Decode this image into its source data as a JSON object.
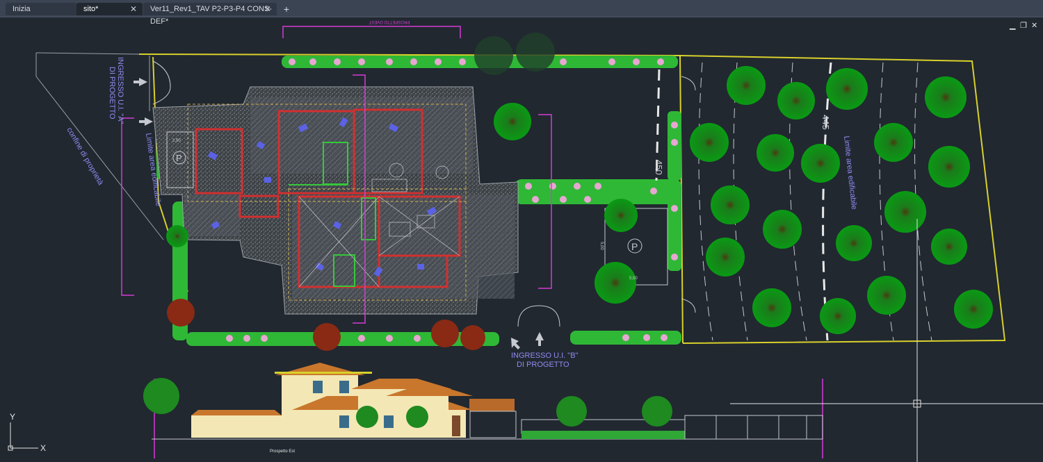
{
  "tabs": [
    {
      "label": "Inizia",
      "active": false,
      "closable": false
    },
    {
      "label": "sito*",
      "active": true,
      "closable": true
    },
    {
      "label": "Ver11_Rev1_TAV P2-P3-P4 CONS-DEF*",
      "active": false,
      "closable": true
    }
  ],
  "tab_close_symbol": "✕",
  "tab_add_symbol": "+",
  "window_controls": {
    "minimize": "▁",
    "restore": "❐",
    "close": "✕"
  },
  "drawing": {
    "entrance_a": "INGRESSO U.I. \"A\" DI PROGETTO",
    "entrance_a_line1": "INGRESSO U.I. \"A\"",
    "entrance_a_line2": "DI PROGETTO",
    "property_line": "confine di proprietà",
    "limit_left": "Limite area edificabile",
    "limit_right": "Limite area edificabile",
    "entrance_b_line1": "INGRESSO U.I. \"B\"",
    "entrance_b_line2": "DI PROGETTO",
    "elevation_title": "Prospetto Est",
    "dim_450": "450",
    "dim_445": "445",
    "parking_symbol": "P",
    "dim_250": "2,50",
    "dim_500": "5,00",
    "dim_550": "5,50",
    "top_section_label": "PROSPETTO OVEST"
  },
  "ucs": {
    "y": "Y",
    "x": "X"
  },
  "colors": {
    "background": "#212830",
    "tabbar": "#3b4453",
    "boundary": "#d9d12b",
    "magenta": "#d63ad6",
    "hedge": "#33c13a",
    "label": "#8f8cf0",
    "wall": "#d23030"
  }
}
